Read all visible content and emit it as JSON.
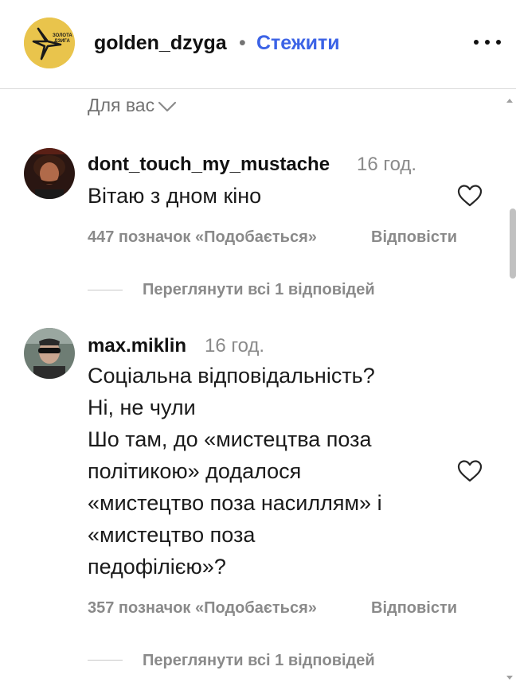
{
  "header": {
    "username": "golden_dzyga",
    "separator": "•",
    "follow_label": "Стежити",
    "logo_text_line1": "ЗОЛОТА",
    "logo_text_line2": "ДЗИГА"
  },
  "filter": {
    "label": "Для вас"
  },
  "comments": [
    {
      "username": "dont_touch_my_mustache",
      "time": "16 год.",
      "lines": [
        "Вітаю з дном кіно"
      ],
      "likes": "447 позначок «Подобається»",
      "reply_label": "Відповісти",
      "view_replies": "Переглянути всі 1 відповідей"
    },
    {
      "username": "max.miklin",
      "time": "16 год.",
      "lines": [
        "Соціальна відповідальність?",
        "Ні, не чули",
        "Шо там, до «мистецтва поза",
        "політикою» додалося",
        "«мистецтво поза насиллям» і",
        "«мистецтво поза",
        "педофілією»?"
      ],
      "likes": "357 позначок «Подобається»",
      "reply_label": "Відповісти",
      "view_replies": "Переглянути всі 1 відповідей"
    }
  ],
  "icons": {
    "more": "more-horizontal-icon",
    "chevron": "chevron-down-icon",
    "heart": "heart-outline-icon"
  },
  "colors": {
    "link_blue": "#3c63e6",
    "secondary_text": "#8a8a8a",
    "logo_gold": "#e9c44c"
  }
}
